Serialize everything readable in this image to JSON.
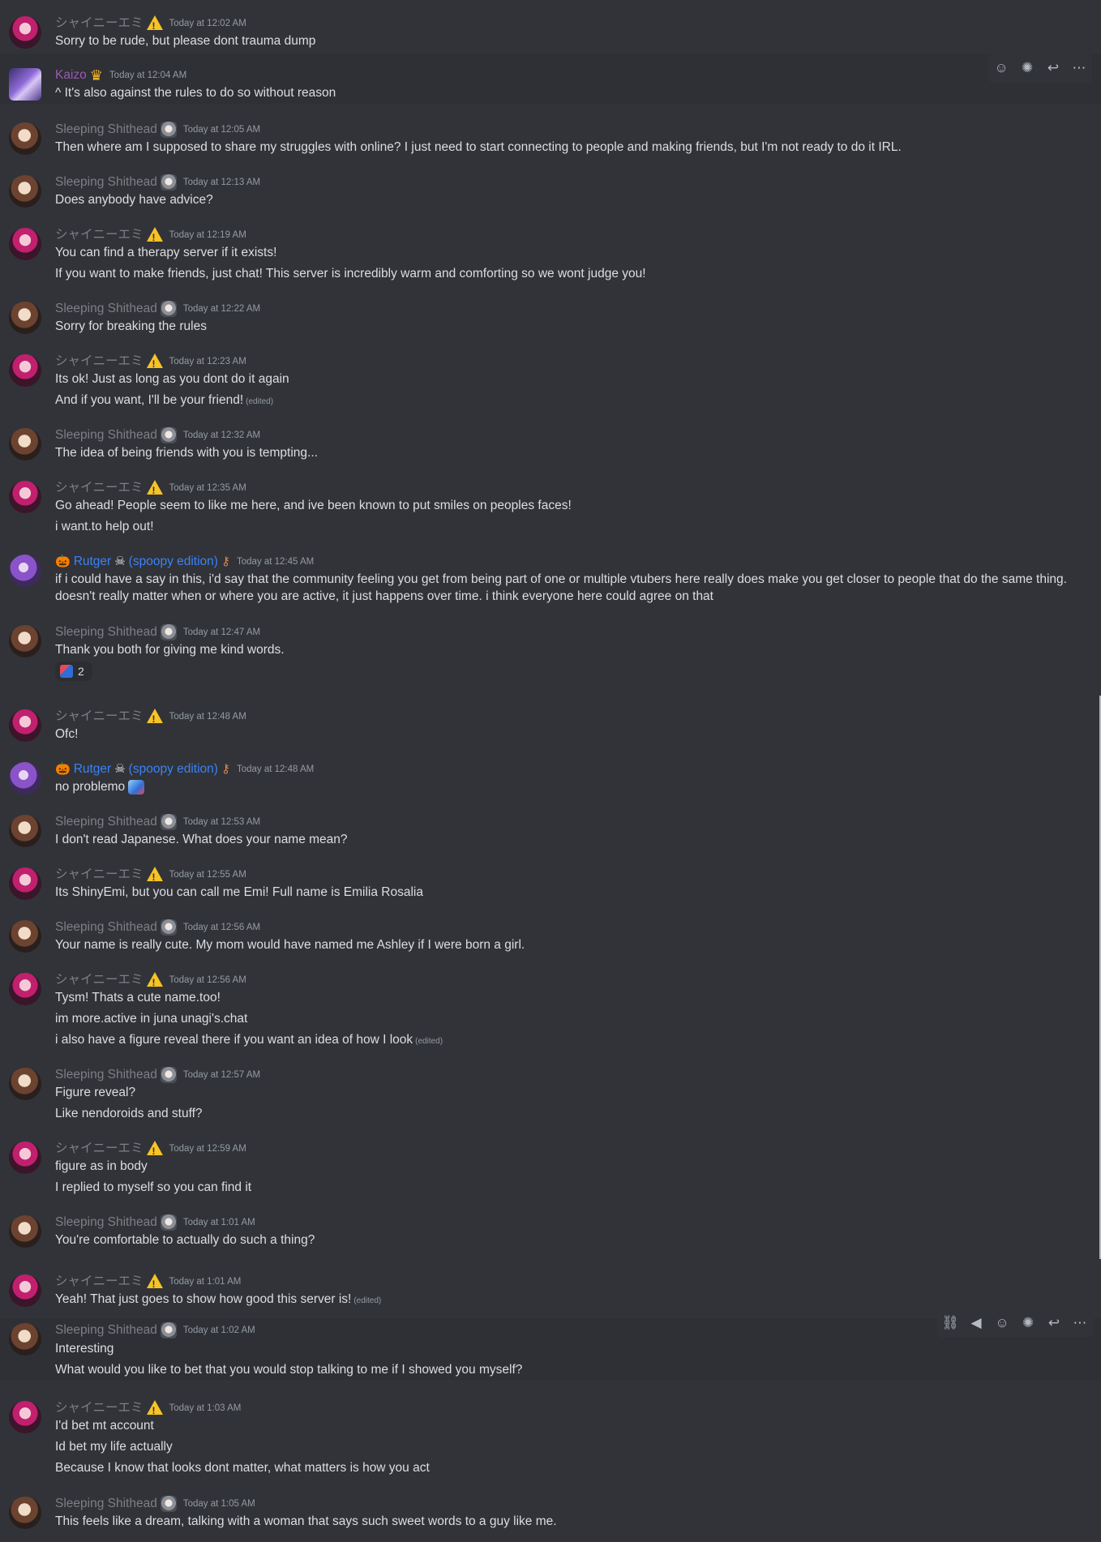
{
  "messages": [
    {
      "author": "シャイニーエミ",
      "badge": "warning",
      "time": "Today at 12:02 AM",
      "lines": [
        "Sorry to be rude, but  please dont trauma dump"
      ]
    },
    {
      "author": "Kaizo",
      "badge": "crown",
      "time": "Today at 12:04 AM",
      "lines": [
        "^ It's also against the rules to do so without reason"
      ]
    },
    {
      "author": "Sleeping Shithead",
      "badge": "avatar",
      "time": "Today at 12:05 AM",
      "lines": [
        "Then where am I supposed to share my struggles with online? I just need to start connecting to people and making friends, but I'm not ready to do it IRL."
      ]
    },
    {
      "author": "Sleeping Shithead",
      "badge": "avatar",
      "time": "Today at 12:13 AM",
      "lines": [
        "Does anybody have advice?"
      ]
    },
    {
      "author": "シャイニーエミ",
      "badge": "warning",
      "time": "Today at 12:19 AM",
      "lines": [
        "You can find a therapy server if it exists!",
        "If you want to make friends, just chat! This server is incredibly warm and comforting so we wont judge you!"
      ]
    },
    {
      "author": "Sleeping Shithead",
      "badge": "avatar",
      "time": "Today at 12:22 AM",
      "lines": [
        "Sorry for breaking the rules"
      ]
    },
    {
      "author": "シャイニーエミ",
      "badge": "warning",
      "time": "Today at 12:23 AM",
      "lines": [
        "Its ok! Just as long as you dont do it again",
        "And if you want, I'll be your friend!"
      ]
    },
    {
      "author": "Sleeping Shithead",
      "badge": "avatar",
      "time": "Today at 12:32 AM",
      "lines": [
        "The idea of being friends with you is tempting..."
      ]
    },
    {
      "author": "シャイニーエミ",
      "badge": "warning",
      "time": "Today at 12:35 AM",
      "lines": [
        "Go ahead! People seem to like me here, and ive been known to put smiles on peoples faces!",
        "i want.to help out!"
      ]
    },
    {
      "author": "Rutger",
      "author_suffix": "(spoopy edition)",
      "badge": "key",
      "time": "Today at 12:45 AM",
      "lines": [
        "if i could have a say in this, i'd say that the community feeling you get from being part of one or multiple vtubers here really does make you get closer to people that do the same thing.",
        "doesn't really matter when or where you are active, it just happens over time. i think everyone here could agree on that"
      ]
    },
    {
      "author": "Sleeping Shithead",
      "badge": "avatar",
      "time": "Today at 12:47 AM",
      "lines": [
        "Thank you both for giving me kind words."
      ],
      "reaction_count": "2"
    },
    {
      "author": "シャイニーエミ",
      "badge": "warning",
      "time": "Today at 12:48 AM",
      "lines": [
        "Ofc!"
      ]
    },
    {
      "author": "Rutger",
      "author_suffix": "(spoopy edition)",
      "badge": "key",
      "time": "Today at 12:48 AM",
      "lines": [
        "no problemo"
      ]
    },
    {
      "author": "Sleeping Shithead",
      "badge": "avatar",
      "time": "Today at 12:53 AM",
      "lines": [
        "I don't read Japanese. What does your name mean?"
      ]
    },
    {
      "author": "シャイニーエミ",
      "badge": "warning",
      "time": "Today at 12:55 AM",
      "lines": [
        "Its ShinyEmi, but you can call me Emi! Full name is Emilia Rosalia"
      ]
    },
    {
      "author": "Sleeping Shithead",
      "badge": "avatar",
      "time": "Today at 12:56 AM",
      "lines": [
        "Your name is really cute. My mom would have named me Ashley if I were born a girl."
      ]
    },
    {
      "author": "シャイニーエミ",
      "badge": "warning",
      "time": "Today at 12:56 AM",
      "lines": [
        "Tysm! Thats a cute name.too!",
        "im more.active in juna unagi's.chat",
        "i also have a figure reveal there if you want an idea of how I look"
      ]
    },
    {
      "author": "Sleeping Shithead",
      "badge": "avatar",
      "time": "Today at 12:57 AM",
      "lines": [
        "Figure reveal?",
        "Like nendoroids and stuff?"
      ]
    },
    {
      "author": "シャイニーエミ",
      "badge": "warning",
      "time": "Today at 12:59 AM",
      "lines": [
        "figure as in body",
        "I replied to myself so you can find it"
      ]
    },
    {
      "author": "Sleeping Shithead",
      "badge": "avatar",
      "time": "Today at 1:01 AM",
      "lines": [
        "You're comfortable to actually do such a thing?"
      ]
    },
    {
      "author": "シャイニーエミ",
      "badge": "warning",
      "time": "Today at 1:01 AM",
      "lines": [
        "Yeah! That just goes to show how good this server is!"
      ]
    },
    {
      "author": "Sleeping Shithead",
      "badge": "avatar",
      "time": "Today at 1:02 AM",
      "lines": [
        "Interesting",
        "What would you like to bet that you would stop talking to me if I showed you myself?"
      ]
    },
    {
      "author": "シャイニーエミ",
      "badge": "warning",
      "time": "Today at 1:03 AM",
      "lines": [
        "I'd bet mt account",
        "Id bet my life actually",
        "Because I know that looks dont matter, what matters is how you act"
      ]
    },
    {
      "author": "Sleeping Shithead",
      "badge": "avatar",
      "time": "Today at 1:05 AM",
      "lines": [
        "This feels like a dream, talking with a woman that says such sweet words to a guy like me."
      ]
    }
  ],
  "edited_label": "(edited)",
  "icons": {
    "toolbar_1": [
      "add-reaction-icon",
      "super-reaction-icon",
      "reply-icon",
      "more-icon"
    ],
    "toolbar_2": [
      "copy-link-icon",
      "mark-unread-icon",
      "add-reaction-icon",
      "super-reaction-icon",
      "reply-icon",
      "more-icon"
    ]
  }
}
